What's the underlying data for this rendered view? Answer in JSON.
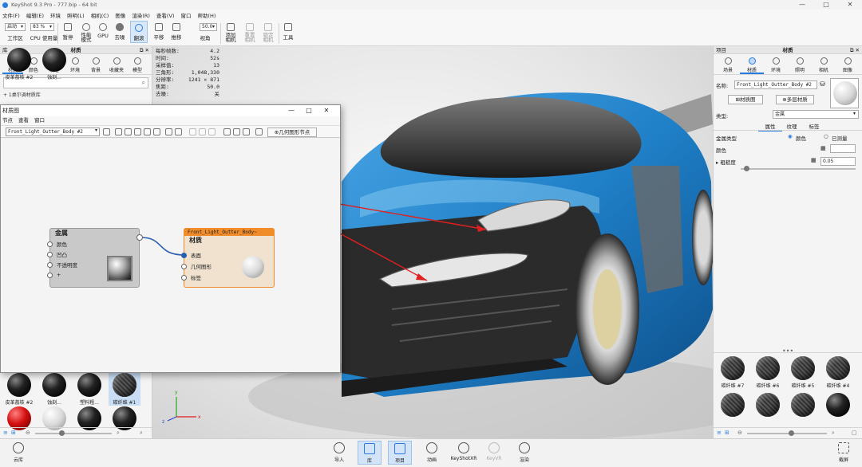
{
  "titlebar": {
    "title": "KeyShot 9.3 Pro  -  777.bip  -  64 bit",
    "min": "—",
    "max": "□",
    "close": "✕"
  },
  "menu": [
    "文件(F)",
    "编辑(E)",
    "环境",
    "照明(L)",
    "相机(C)",
    "图像",
    "渲染(R)",
    "查看(V)",
    "窗口",
    "帮助(H)"
  ],
  "toolbar": {
    "workspace_select": "启动",
    "workspace_label": "工作区",
    "cpu_select": "83 %",
    "cpu_label": "CPU 使用量",
    "pause_label": "暂停",
    "perf_label": "性能\n模式",
    "gpu_label": "GPU",
    "denoise_label": "去噪",
    "refresh_label": "翻滚",
    "pan_label": "平移",
    "dolly_label": "推移",
    "fov_value": "50.0",
    "view_label": "视角",
    "add_camera_label": "添加\n相机",
    "reset_camera_label": "重置\n相机",
    "lock_camera_label": "锁定\n相机",
    "tools_label": "工具"
  },
  "library": {
    "header": "库",
    "panel_title": "材质",
    "tabs": [
      "材质",
      "颜色",
      "纹理",
      "环境",
      "背景",
      "收藏夹",
      "模型"
    ],
    "tree_item": "+ 1桌尔调材质库",
    "thumbs_row1": [
      "皮革荔枝 #2",
      "蚀刻...",
      "塑料粗...",
      "碳纤维 #1"
    ],
    "bottom_icons": [
      "≡",
      "⊞"
    ]
  },
  "stats": [
    {
      "k": "每秒帧数:",
      "v": "4.2"
    },
    {
      "k": "时间:",
      "v": "52s"
    },
    {
      "k": "采样值:",
      "v": "13"
    },
    {
      "k": "三角形:",
      "v": "1,048,330"
    },
    {
      "k": "分辨率:",
      "v": "1241 × 871"
    },
    {
      "k": "焦距:",
      "v": "50.0"
    },
    {
      "k": "去噪:",
      "v": "关"
    }
  ],
  "graph": {
    "window_title": "材质图",
    "menu": [
      "节点",
      "查看",
      "窗口"
    ],
    "material_name": "Front_Light_Outter_Body #2",
    "geometry_node_btn": "几何图形节点",
    "metal_node": {
      "title": "金属",
      "ports": [
        "颜色",
        "凹凸",
        "不透明度",
        "+"
      ]
    },
    "material_node": {
      "title": "材质",
      "subtitle": "Front_Light_Outter_Body~",
      "ports": [
        "表面",
        "几何图形",
        "标签"
      ]
    }
  },
  "project": {
    "header": "项目",
    "panel_title": "材质",
    "tabs": [
      "场景",
      "材质",
      "环境",
      "照明",
      "相机",
      "图像"
    ],
    "name_label": "名称:",
    "name_value": "Front_Light_Outter_Body #2",
    "material_graph_btn": "材质图",
    "multi_layer_btn": "多层材质",
    "type_label": "类型:",
    "type_value": "金属",
    "subtabs": [
      "属性",
      "纹理",
      "标签"
    ],
    "metal_type_label": "金属类型",
    "metal_type_opt1": "颜色",
    "metal_type_opt2": "已测量",
    "color_label": "颜色",
    "roughness_label": "粗糙度",
    "roughness_value": "0.05",
    "roughness": 0.05,
    "thumbs_row1": [
      "碳纤维 #7",
      "碳纤维 #6",
      "碳纤维 #5",
      "碳纤维 #4"
    ]
  },
  "bottombar": {
    "cloud_label": "云库",
    "items": [
      "导入",
      "库",
      "项目",
      "动画",
      "KeyShotXR",
      "KeyVR",
      "渲染"
    ],
    "screenshot_label": "截屏"
  },
  "colors": {
    "accent": "#2a7be0",
    "node_orange": "#f08c2a",
    "car_blue": "#1f7fc7"
  }
}
